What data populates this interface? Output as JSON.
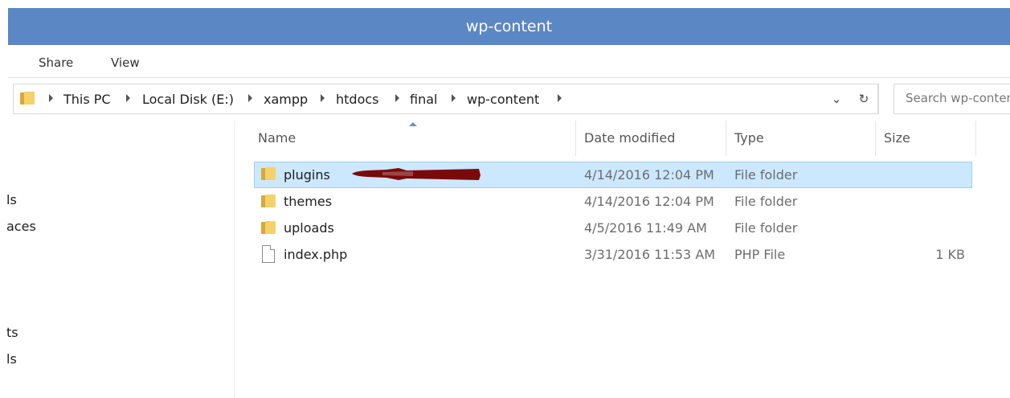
{
  "window": {
    "title": "wp-content"
  },
  "ribbon": {
    "tabs": [
      "Share",
      "View"
    ]
  },
  "address": {
    "crumbs": [
      "This PC",
      "Local Disk (E:)",
      "xampp",
      "htdocs",
      "final",
      "wp-content"
    ],
    "dropdown_icon": "chevron-down-icon",
    "refresh_icon": "refresh-icon"
  },
  "search": {
    "placeholder": "Search wp-content"
  },
  "nav": {
    "items": [
      "ls",
      "aces",
      "ts",
      "ls"
    ]
  },
  "columns": {
    "name": "Name",
    "date": "Date modified",
    "type": "Type",
    "size": "Size"
  },
  "files": [
    {
      "name": "plugins",
      "date": "4/14/2016 12:04 PM",
      "type": "File folder",
      "size": "",
      "icon": "folder-icon",
      "selected": true
    },
    {
      "name": "themes",
      "date": "4/14/2016 12:04 PM",
      "type": "File folder",
      "size": "",
      "icon": "folder-icon",
      "selected": false
    },
    {
      "name": "uploads",
      "date": "4/5/2016 11:49 AM",
      "type": "File folder",
      "size": "",
      "icon": "folder-icon",
      "selected": false
    },
    {
      "name": "index.php",
      "date": "3/31/2016 11:53 AM",
      "type": "PHP File",
      "size": "1 KB",
      "icon": "file-icon",
      "selected": false
    }
  ],
  "colors": {
    "titlebar": "#5c87c5",
    "selection": "#cce8ff",
    "selection_border": "#99d1ff",
    "annotation": "#7a0a0a"
  }
}
